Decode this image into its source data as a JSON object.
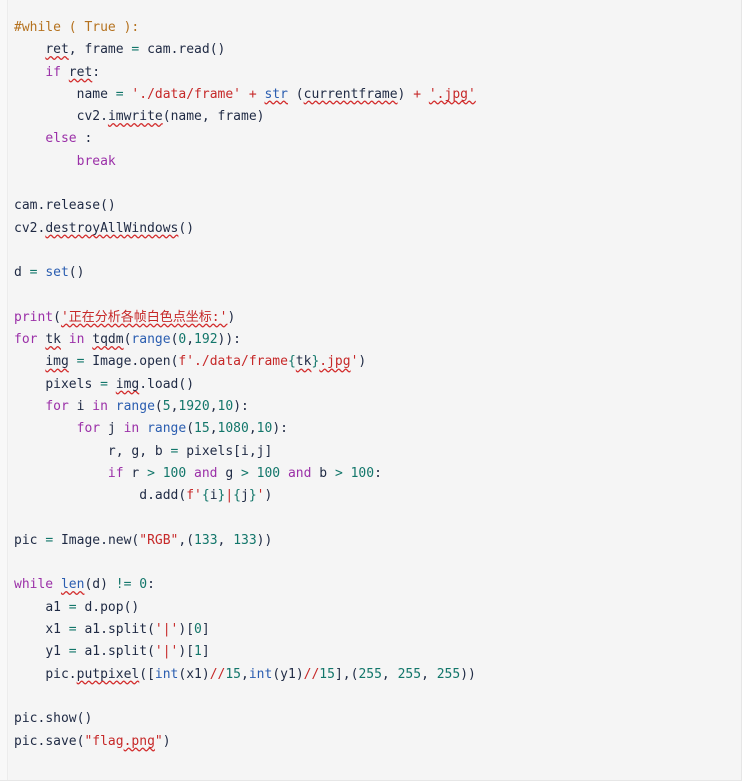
{
  "editor": {
    "language": "python",
    "background_color": "#f5f5f5",
    "gutter_color": "#f8f8f8",
    "default_text_color": "#1f2a44",
    "spellcheck_underline_color": "#d32f2f"
  },
  "syntax_colors": {
    "comment": "#b5721f",
    "keyword": "#9b30a8",
    "builtin": "#2a5db0",
    "string": "#c62828",
    "number": "#12766a",
    "operator": "#12766a",
    "operator_alt": "#c62828",
    "plain": "#1f2a44"
  },
  "code": {
    "lines": [
      "#while ( True ):",
      "    ret, frame = cam.read()",
      "    if ret:",
      "        name = './data/frame' + str (currentframe) + '.jpg'",
      "        cv2.imwrite(name, frame)",
      "    else :",
      "        break",
      "",
      "cam.release()",
      "cv2.destroyAllWindows()",
      "",
      "d = set()",
      "",
      "print('正在分析各帧白色点坐标:')",
      "for tk in tqdm(range(0,192)):",
      "    img = Image.open(f'./data/frame{tk}.jpg')",
      "    pixels = img.load()",
      "    for i in range(5,1920,10):",
      "        for j in range(15,1080,10):",
      "            r, g, b = pixels[i,j]",
      "            if r > 100 and g > 100 and b > 100:",
      "                d.add(f'{i}|{j}')",
      "",
      "pic = Image.new(\"RGB\",(133, 133))",
      "",
      "while len(d) != 0:",
      "    a1 = d.pop()",
      "    x1 = a1.split('|')[0]",
      "    y1 = a1.split('|')[1]",
      "    pic.putpixel([int(x1)//15,int(y1)//15],(255, 255, 255))",
      "",
      "pic.show()",
      "pic.save(\"flag.png\")"
    ],
    "misspelled_words": [
      "ret",
      "currentframe",
      "imwrite",
      "destroyAllWindows",
      "tqdm",
      "img",
      "jpg",
      "tk",
      "len",
      "putpixel",
      "png"
    ],
    "chinese_string": "正在分析各帧白色点坐标:",
    "numbers": [
      "0",
      "192",
      "5",
      "1920",
      "10",
      "15",
      "1080",
      "100",
      "133",
      "1",
      "255"
    ],
    "strings": [
      "'./data/frame'",
      "'.jpg'",
      "'./data/frame{tk}.jpg'",
      "'{i}|{j}'",
      "\"RGB\"",
      "'|'",
      "\"flag.png\""
    ]
  }
}
